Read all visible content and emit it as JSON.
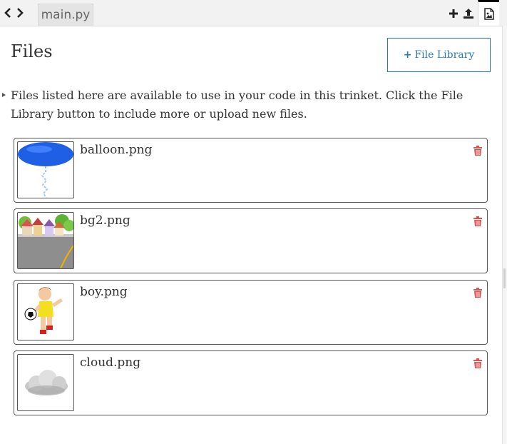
{
  "tabs": {
    "active": "main.py"
  },
  "panel": {
    "title": "Files",
    "library_button": "File Library",
    "info": "Files listed here are available to use in your code in this trinket. Click the File Library button to include more or upload new files."
  },
  "files": [
    {
      "name": "balloon.png"
    },
    {
      "name": "bg2.png"
    },
    {
      "name": "boy.png"
    },
    {
      "name": "cloud.png"
    }
  ],
  "colors": {
    "accent": "#2a7ab0",
    "delete": "#d9534f"
  }
}
